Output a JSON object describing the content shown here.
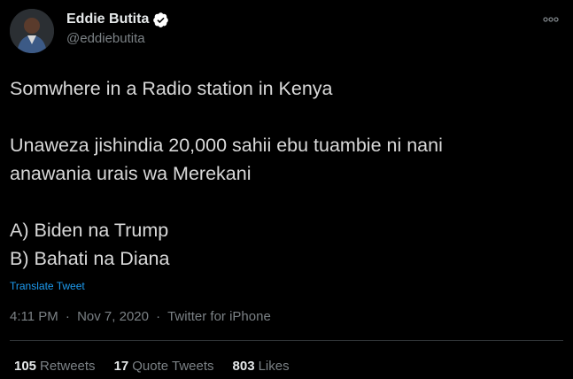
{
  "author": {
    "display_name": "Eddie Butita",
    "handle": "@eddiebutita",
    "verified": true
  },
  "tweet": {
    "lines": [
      "Somwhere in a Radio station in Kenya",
      "",
      "Unaweza jishindia 20,000 sahii ebu tuambie ni nani",
      "anawania urais wa Merekani",
      "",
      "A) Biden na Trump",
      "B) Bahati na Diana"
    ],
    "translate_label": "Translate Tweet",
    "time": "4:11 PM",
    "date": "Nov 7, 2020",
    "source": "Twitter for iPhone",
    "separator": "·"
  },
  "stats": {
    "retweets_count": "105",
    "retweets_label": "Retweets",
    "quotes_count": "17",
    "quotes_label": "Quote Tweets",
    "likes_count": "803",
    "likes_label": "Likes"
  },
  "colors": {
    "background": "#000000",
    "link": "#1d9bf0",
    "verified_badge": "#ffffff",
    "muted_text": "#7b8185"
  }
}
